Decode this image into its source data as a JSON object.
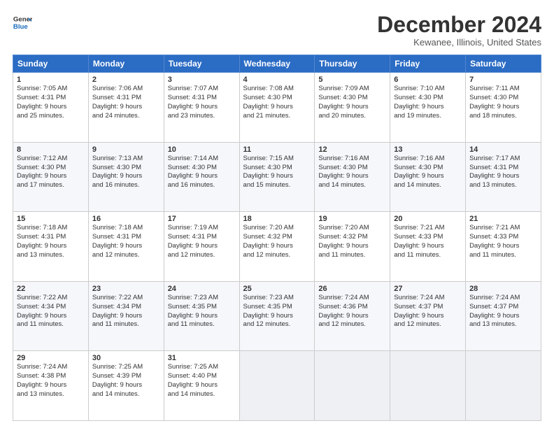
{
  "header": {
    "logo_line1": "General",
    "logo_line2": "Blue",
    "month_title": "December 2024",
    "location": "Kewanee, Illinois, United States"
  },
  "weekdays": [
    "Sunday",
    "Monday",
    "Tuesday",
    "Wednesday",
    "Thursday",
    "Friday",
    "Saturday"
  ],
  "weeks": [
    [
      {
        "num": "1",
        "lines": [
          "Sunrise: 7:05 AM",
          "Sunset: 4:31 PM",
          "Daylight: 9 hours",
          "and 25 minutes."
        ]
      },
      {
        "num": "2",
        "lines": [
          "Sunrise: 7:06 AM",
          "Sunset: 4:31 PM",
          "Daylight: 9 hours",
          "and 24 minutes."
        ]
      },
      {
        "num": "3",
        "lines": [
          "Sunrise: 7:07 AM",
          "Sunset: 4:31 PM",
          "Daylight: 9 hours",
          "and 23 minutes."
        ]
      },
      {
        "num": "4",
        "lines": [
          "Sunrise: 7:08 AM",
          "Sunset: 4:30 PM",
          "Daylight: 9 hours",
          "and 21 minutes."
        ]
      },
      {
        "num": "5",
        "lines": [
          "Sunrise: 7:09 AM",
          "Sunset: 4:30 PM",
          "Daylight: 9 hours",
          "and 20 minutes."
        ]
      },
      {
        "num": "6",
        "lines": [
          "Sunrise: 7:10 AM",
          "Sunset: 4:30 PM",
          "Daylight: 9 hours",
          "and 19 minutes."
        ]
      },
      {
        "num": "7",
        "lines": [
          "Sunrise: 7:11 AM",
          "Sunset: 4:30 PM",
          "Daylight: 9 hours",
          "and 18 minutes."
        ]
      }
    ],
    [
      {
        "num": "8",
        "lines": [
          "Sunrise: 7:12 AM",
          "Sunset: 4:30 PM",
          "Daylight: 9 hours",
          "and 17 minutes."
        ]
      },
      {
        "num": "9",
        "lines": [
          "Sunrise: 7:13 AM",
          "Sunset: 4:30 PM",
          "Daylight: 9 hours",
          "and 16 minutes."
        ]
      },
      {
        "num": "10",
        "lines": [
          "Sunrise: 7:14 AM",
          "Sunset: 4:30 PM",
          "Daylight: 9 hours",
          "and 16 minutes."
        ]
      },
      {
        "num": "11",
        "lines": [
          "Sunrise: 7:15 AM",
          "Sunset: 4:30 PM",
          "Daylight: 9 hours",
          "and 15 minutes."
        ]
      },
      {
        "num": "12",
        "lines": [
          "Sunrise: 7:16 AM",
          "Sunset: 4:30 PM",
          "Daylight: 9 hours",
          "and 14 minutes."
        ]
      },
      {
        "num": "13",
        "lines": [
          "Sunrise: 7:16 AM",
          "Sunset: 4:30 PM",
          "Daylight: 9 hours",
          "and 14 minutes."
        ]
      },
      {
        "num": "14",
        "lines": [
          "Sunrise: 7:17 AM",
          "Sunset: 4:31 PM",
          "Daylight: 9 hours",
          "and 13 minutes."
        ]
      }
    ],
    [
      {
        "num": "15",
        "lines": [
          "Sunrise: 7:18 AM",
          "Sunset: 4:31 PM",
          "Daylight: 9 hours",
          "and 13 minutes."
        ]
      },
      {
        "num": "16",
        "lines": [
          "Sunrise: 7:18 AM",
          "Sunset: 4:31 PM",
          "Daylight: 9 hours",
          "and 12 minutes."
        ]
      },
      {
        "num": "17",
        "lines": [
          "Sunrise: 7:19 AM",
          "Sunset: 4:31 PM",
          "Daylight: 9 hours",
          "and 12 minutes."
        ]
      },
      {
        "num": "18",
        "lines": [
          "Sunrise: 7:20 AM",
          "Sunset: 4:32 PM",
          "Daylight: 9 hours",
          "and 12 minutes."
        ]
      },
      {
        "num": "19",
        "lines": [
          "Sunrise: 7:20 AM",
          "Sunset: 4:32 PM",
          "Daylight: 9 hours",
          "and 11 minutes."
        ]
      },
      {
        "num": "20",
        "lines": [
          "Sunrise: 7:21 AM",
          "Sunset: 4:33 PM",
          "Daylight: 9 hours",
          "and 11 minutes."
        ]
      },
      {
        "num": "21",
        "lines": [
          "Sunrise: 7:21 AM",
          "Sunset: 4:33 PM",
          "Daylight: 9 hours",
          "and 11 minutes."
        ]
      }
    ],
    [
      {
        "num": "22",
        "lines": [
          "Sunrise: 7:22 AM",
          "Sunset: 4:34 PM",
          "Daylight: 9 hours",
          "and 11 minutes."
        ]
      },
      {
        "num": "23",
        "lines": [
          "Sunrise: 7:22 AM",
          "Sunset: 4:34 PM",
          "Daylight: 9 hours",
          "and 11 minutes."
        ]
      },
      {
        "num": "24",
        "lines": [
          "Sunrise: 7:23 AM",
          "Sunset: 4:35 PM",
          "Daylight: 9 hours",
          "and 11 minutes."
        ]
      },
      {
        "num": "25",
        "lines": [
          "Sunrise: 7:23 AM",
          "Sunset: 4:35 PM",
          "Daylight: 9 hours",
          "and 12 minutes."
        ]
      },
      {
        "num": "26",
        "lines": [
          "Sunrise: 7:24 AM",
          "Sunset: 4:36 PM",
          "Daylight: 9 hours",
          "and 12 minutes."
        ]
      },
      {
        "num": "27",
        "lines": [
          "Sunrise: 7:24 AM",
          "Sunset: 4:37 PM",
          "Daylight: 9 hours",
          "and 12 minutes."
        ]
      },
      {
        "num": "28",
        "lines": [
          "Sunrise: 7:24 AM",
          "Sunset: 4:37 PM",
          "Daylight: 9 hours",
          "and 13 minutes."
        ]
      }
    ],
    [
      {
        "num": "29",
        "lines": [
          "Sunrise: 7:24 AM",
          "Sunset: 4:38 PM",
          "Daylight: 9 hours",
          "and 13 minutes."
        ]
      },
      {
        "num": "30",
        "lines": [
          "Sunrise: 7:25 AM",
          "Sunset: 4:39 PM",
          "Daylight: 9 hours",
          "and 14 minutes."
        ]
      },
      {
        "num": "31",
        "lines": [
          "Sunrise: 7:25 AM",
          "Sunset: 4:40 PM",
          "Daylight: 9 hours",
          "and 14 minutes."
        ]
      },
      {
        "num": "",
        "lines": []
      },
      {
        "num": "",
        "lines": []
      },
      {
        "num": "",
        "lines": []
      },
      {
        "num": "",
        "lines": []
      }
    ]
  ]
}
